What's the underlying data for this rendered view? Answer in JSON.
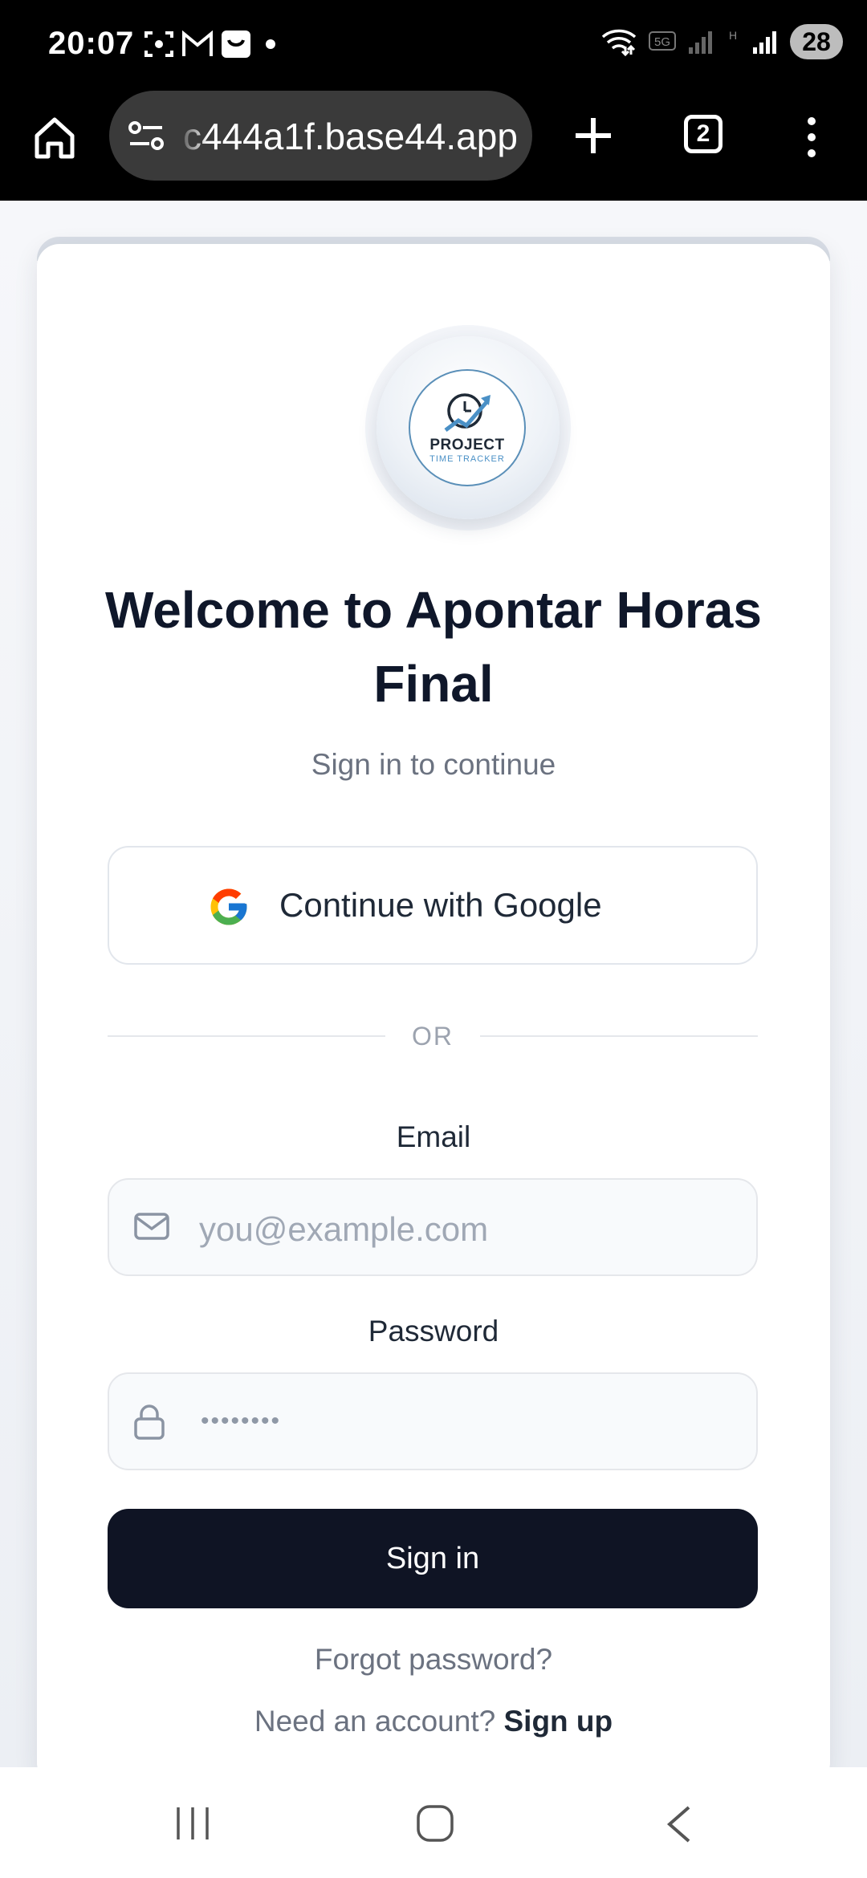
{
  "status_bar": {
    "time": "20:07",
    "network": "5G",
    "network2": "H",
    "battery": "28"
  },
  "browser": {
    "url": "c444a1f.base44.app",
    "tab_count": "2"
  },
  "logo": {
    "title": "PROJECT",
    "subtitle": "TIME TRACKER"
  },
  "auth": {
    "title": "Welcome to Apontar Horas Final",
    "subtitle": "Sign in to continue",
    "google_label": "Continue with Google",
    "divider": "OR",
    "email_label": "Email",
    "email_placeholder": "you@example.com",
    "password_label": "Password",
    "password_placeholder": "••••••••",
    "signin_label": "Sign in",
    "forgot_label": "Forgot password?",
    "need_account": "Need an account?",
    "signup_label": "Sign up"
  },
  "colors": {
    "primary_button": "#0f1424",
    "text_dark": "#0f172a",
    "text_muted": "#6b7280"
  }
}
